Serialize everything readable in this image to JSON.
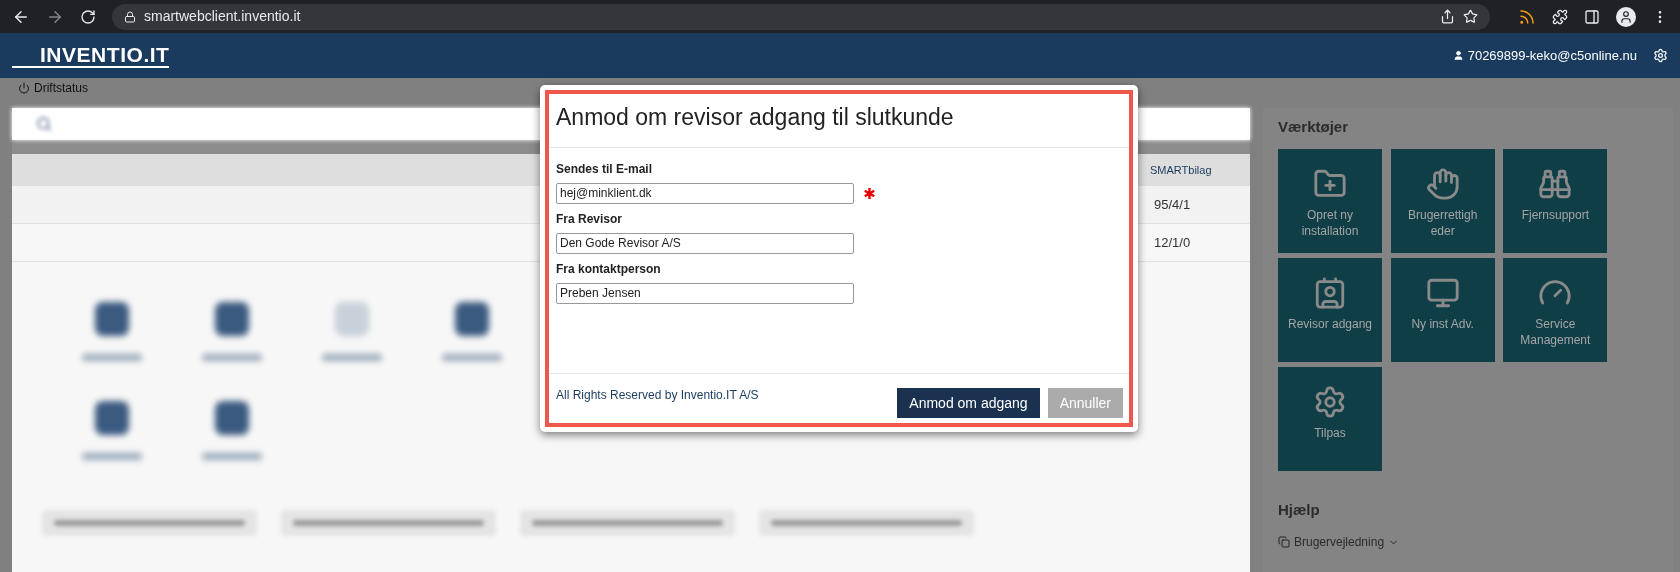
{
  "browser": {
    "url": "smartwebclient.inventio.it"
  },
  "header": {
    "logo": "INVENTIO.IT",
    "user": "70269899-keko@c5online.nu"
  },
  "status_link": "Driftstatus",
  "table": {
    "column_header": "SMARTbilag",
    "cells": [
      "95/4/1",
      "12/1/0"
    ]
  },
  "tools": {
    "title": "Værktøjer",
    "tiles": [
      {
        "label": "Opret ny installation"
      },
      {
        "label": "Brugerrettigh eder"
      },
      {
        "label": "Fjernsupport"
      },
      {
        "label": "Revisor adgang"
      },
      {
        "label": "Ny inst Adv."
      },
      {
        "label": "Service Management"
      },
      {
        "label": "Tilpas"
      }
    ]
  },
  "help": {
    "title": "Hjælp",
    "link": "Brugervejledning"
  },
  "modal": {
    "title": "Anmod om revisor adgang til slutkunde",
    "fields": [
      {
        "label": "Sendes til E-mail",
        "value": "hej@minklient.dk",
        "required": true
      },
      {
        "label": "Fra Revisor",
        "value": "Den Gode Revisor A/S",
        "required": false
      },
      {
        "label": "Fra kontaktperson",
        "value": "Preben Jensen",
        "required": false
      }
    ],
    "footer_text": "All Rights Reserved by Inventio.IT A/S",
    "buttons": [
      {
        "label": "Anmod om adgang",
        "disabled": false
      },
      {
        "label": "Annuller",
        "disabled": true
      }
    ]
  }
}
